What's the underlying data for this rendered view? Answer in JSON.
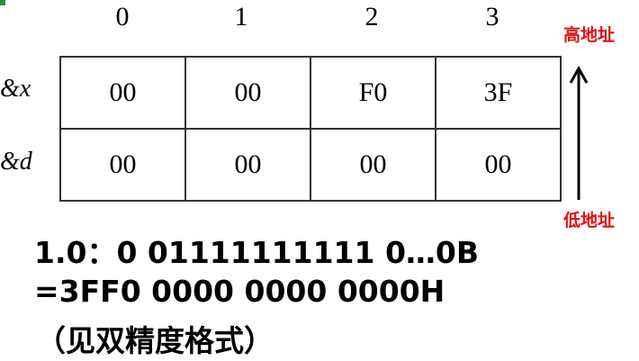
{
  "columns": [
    "0",
    "1",
    "2",
    "3"
  ],
  "rows": [
    {
      "label": "&x",
      "cells": [
        "00",
        "00",
        "F0",
        "3F"
      ]
    },
    {
      "label": "&d",
      "cells": [
        "00",
        "00",
        "00",
        "00"
      ]
    }
  ],
  "address": {
    "high": "高地址",
    "low": "低地址"
  },
  "notes": {
    "line1": "1.0：0 01111111111 0…0B",
    "line2": "=3FF0 0000 0000 0000H",
    "line3": "（见双精度格式）"
  },
  "colors": {
    "address_label": "#e01010",
    "marker": "#2e8b3a"
  }
}
